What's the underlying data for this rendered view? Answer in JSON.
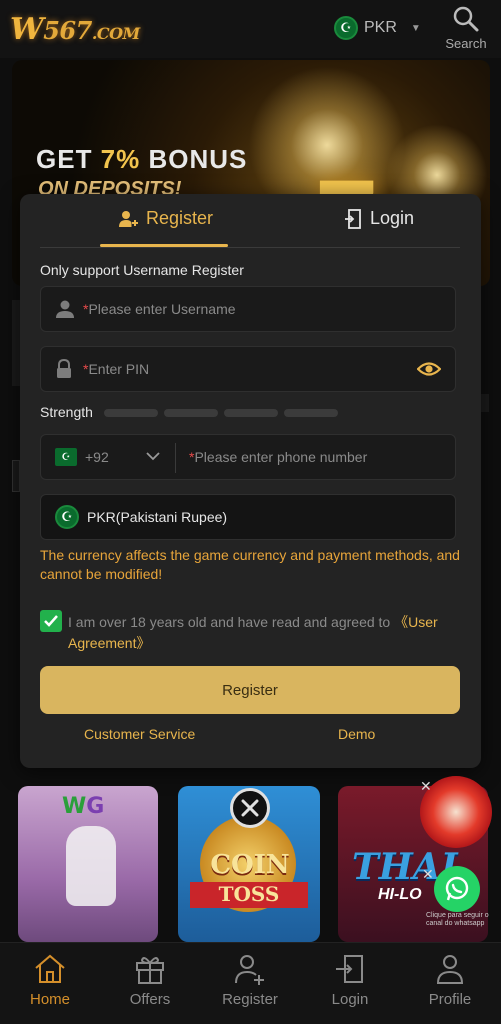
{
  "header": {
    "logo": {
      "w": "W",
      "rest": "567",
      "com": ".COM"
    },
    "currency_code": "PKR",
    "search_label": "Search"
  },
  "banner": {
    "line1_prefix": "GET ",
    "line1_highlight": "7%",
    "line1_suffix": " BONUS",
    "line2": "ON DEPOSITS!"
  },
  "modal": {
    "tabs": [
      {
        "label": "Register",
        "active": true
      },
      {
        "label": "Login",
        "active": false
      }
    ],
    "note": "Only support Username Register",
    "username": {
      "required_mark": "*",
      "placeholder": "Please enter Username"
    },
    "pin": {
      "required_mark": "*",
      "placeholder": "Enter PIN"
    },
    "strength_label": "Strength",
    "strength_level": 0,
    "phone": {
      "country_code": "+92",
      "required_mark": "*",
      "placeholder": "Please enter phone number"
    },
    "currency_field": "PKR(Pakistani Rupee)",
    "currency_warning": "The currency affects the game currency and payment methods, and cannot be modified!",
    "agreement": {
      "checked": true,
      "text": "I am over 18 years old and have read and agreed to ",
      "link": "《User Agreement》"
    },
    "register_button": "Register",
    "customer_service": "Customer Service",
    "demo": "Demo"
  },
  "games": {
    "card1_logo_w": "W",
    "card1_logo_g": "G",
    "card2_title": "COIN",
    "card2_subtitle": "TOSS",
    "card3_title": "THAI",
    "card3_subtitle": "HI-LO"
  },
  "whatsapp_note": "Clique para seguir o canal do whatsapp",
  "bottom_nav": [
    {
      "label": "Home",
      "active": true
    },
    {
      "label": "Offers",
      "active": false
    },
    {
      "label": "Register",
      "active": false
    },
    {
      "label": "Login",
      "active": false
    },
    {
      "label": "Profile",
      "active": false
    }
  ],
  "colors": {
    "accent": "#e8b54d",
    "warning": "#e8a53a",
    "checkbox": "#22b14c",
    "button": "#d9b55f",
    "required": "#e84a4a"
  }
}
